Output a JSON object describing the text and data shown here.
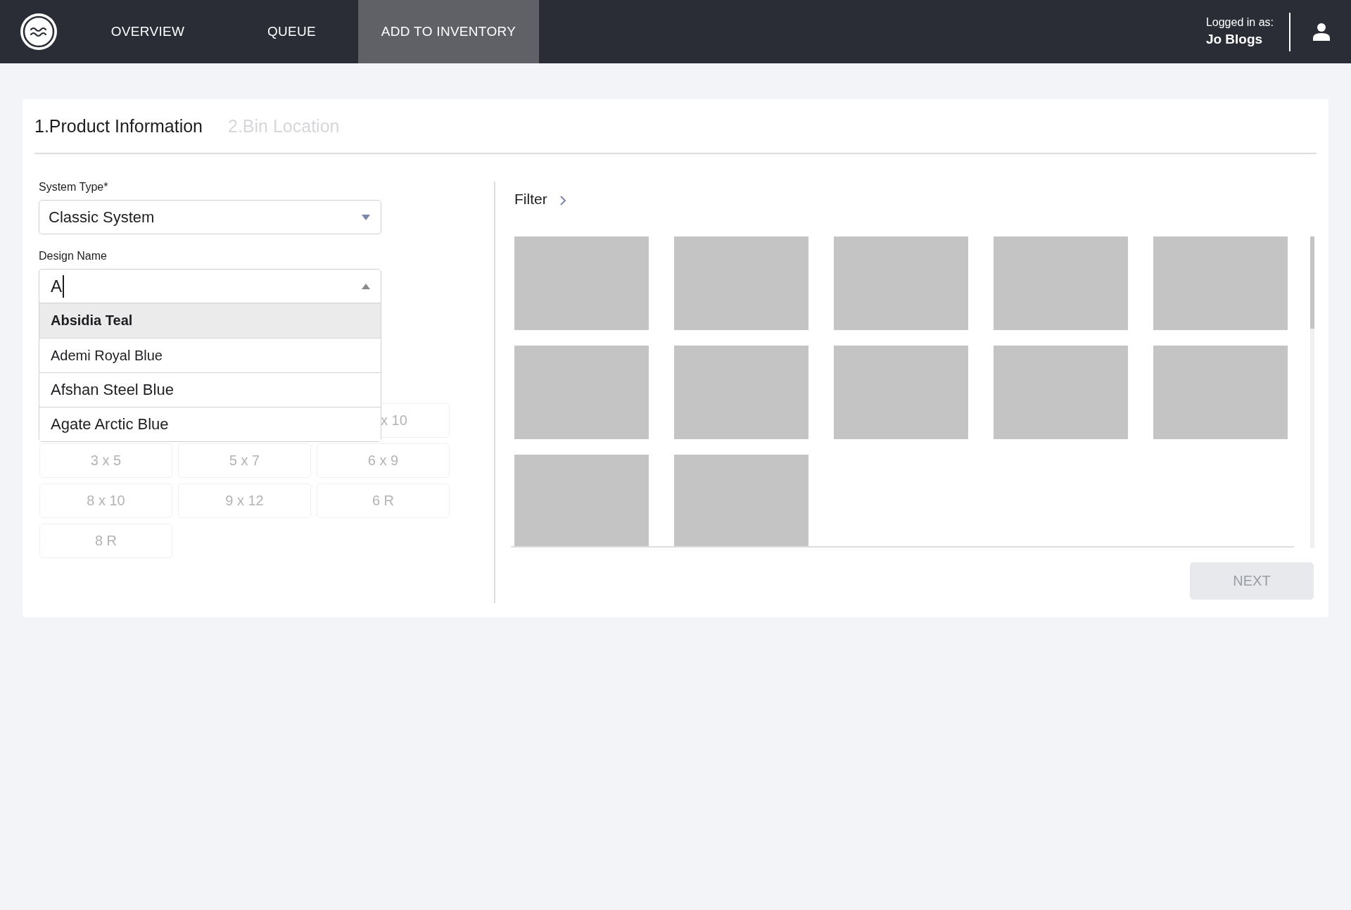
{
  "nav": {
    "items": [
      {
        "label": "OVERVIEW",
        "selected": false
      },
      {
        "label": "QUEUE",
        "selected": false
      },
      {
        "label": "ADD TO INVENTORY",
        "selected": true
      }
    ],
    "user": {
      "caption": "Logged in as:",
      "name": "Jo Blogs"
    }
  },
  "steps": [
    {
      "label": "1.Product Information",
      "active": true
    },
    {
      "label": "2.Bin Location",
      "active": false
    }
  ],
  "form": {
    "system_type": {
      "label": "System Type*",
      "value": "Classic System",
      "expanded": false
    },
    "design_name": {
      "label": "Design Name",
      "value": "A",
      "expanded": true,
      "options": [
        {
          "label": "Absidia Teal",
          "selected": true
        },
        {
          "label": "Ademi Royal Blue",
          "selected": false
        },
        {
          "label": "Afshan Steel Blue",
          "selected": false
        },
        {
          "label": "Agate Arctic Blue",
          "selected": false
        }
      ]
    },
    "sizes": [
      {
        "label": "x 10",
        "kind": "partial"
      },
      {
        "label": "3 x 5",
        "kind": "full"
      },
      {
        "label": "5 x 7",
        "kind": "full"
      },
      {
        "label": "6 x 9",
        "kind": "full"
      },
      {
        "label": "8 x 10",
        "kind": "full"
      },
      {
        "label": "9 x 12",
        "kind": "full"
      },
      {
        "label": "6 R",
        "kind": "full"
      },
      {
        "label": "8 R",
        "kind": "full"
      }
    ]
  },
  "gallery": {
    "filter_label": "Filter",
    "tiles": [
      {
        "kind": "placeholder"
      },
      {
        "kind": "placeholder"
      },
      {
        "kind": "placeholder"
      },
      {
        "kind": "placeholder"
      },
      {
        "kind": "placeholder"
      },
      {
        "kind": "placeholder"
      },
      {
        "kind": "placeholder"
      },
      {
        "kind": "placeholder"
      },
      {
        "kind": "placeholder"
      },
      {
        "kind": "placeholder"
      },
      {
        "kind": "placeholder"
      },
      {
        "kind": "placeholder"
      }
    ]
  },
  "next_button": {
    "label": "NEXT",
    "disabled": true
  }
}
